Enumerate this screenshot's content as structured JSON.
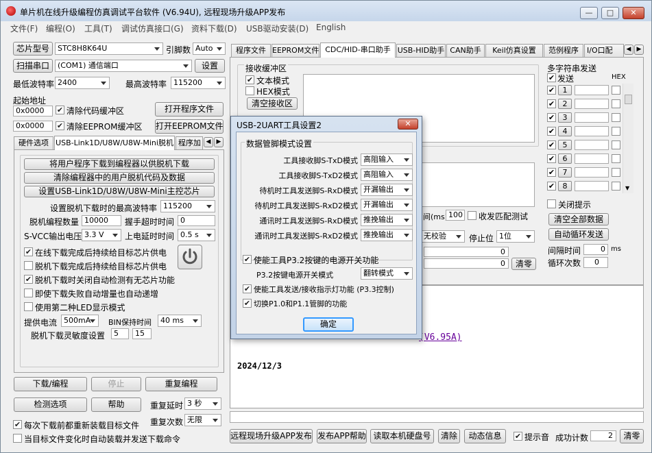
{
  "window": {
    "title": "单片机在线升级编程仿真调试平台软件 (V6.94U), 远程现场升级APP发布",
    "min": "—",
    "max": "□",
    "close": "✕"
  },
  "menu": [
    "文件(F)",
    "编程(O)",
    "工具(T)",
    "调试仿真接口(G)",
    "资料下载(D)",
    "USB驱动安装(D)",
    "English"
  ],
  "left": {
    "chip_model_btn": "芯片型号",
    "chip_model_value": "STC8H8K64U",
    "pin_count_label": "引脚数",
    "pin_count_value": "Auto",
    "scan_port_btn": "扫描串口",
    "port_value": "(COM1) 通信端口",
    "settings_btn": "设置",
    "min_baud_label": "最低波特率",
    "min_baud_value": "2400",
    "max_baud_label": "最高波特率",
    "max_baud_value": "115200",
    "start_addr_label": "起始地址",
    "code_addr": "0x0000",
    "clear_code_buf": "清除代码缓冲区",
    "open_program_btn": "打开程序文件",
    "eeprom_addr": "0x0000",
    "clear_eeprom_buf": "清除EEPROM缓冲区",
    "open_eeprom_btn": "打开EEPROM文件",
    "tabs": [
      "硬件选项",
      "USB-Link1D/U8W/U8W-Mini脱机",
      "程序加"
    ],
    "offline": {
      "btn_download_user": "将用户程序下载到编程器以供脱机下载",
      "btn_clear_user": "清除编程器中的用户脱机代码及数据",
      "btn_set_mini": "设置USB-Link1D/U8W/U8W-Mini主控芯片",
      "max_baud_label": "设置脱机下载时的最高波特率",
      "max_baud_value": "115200",
      "count_label": "脱机编程数量",
      "count_value": "10000",
      "handshake_label": "握手超时时间",
      "handshake_value": "0",
      "svcc_label": "S-VCC输出电压",
      "svcc_value": "3.3 V",
      "power_delay_label": "上电延时时间",
      "power_delay_value": "0.5 s",
      "chk1": "在线下载完成后持续给目标芯片供电",
      "chk2": "脱机下载完成后持续给目标芯片供电",
      "chk3": "脱机下载时关闭自动检测有无芯片功能",
      "chk4": "即使下载失败自动增量也自动递增",
      "chk5": "使用第二种LED显示模式",
      "current_label": "提供电流",
      "current_value": "500mA",
      "bin_hold_label": "BIN保持时间",
      "bin_hold_value": "40 ms",
      "sensitivity_label": "脱机下载灵敏度设置",
      "sens1": "5",
      "sens2": "15"
    },
    "download_btn": "下载/编程",
    "stop_btn": "停止",
    "reprogram_btn": "重复编程",
    "detect_btn": "检测选项",
    "help_btn": "帮助",
    "repeat_delay_label": "重复延时",
    "repeat_delay_value": "3 秒",
    "repeat_count_label": "重复次数",
    "repeat_count_value": "无限",
    "reload_chk": "每次下载前都重新装载目标文件",
    "auto_load_chk": "当目标文件变化时自动装载并发送下载命令"
  },
  "right": {
    "tabs": [
      "程序文件",
      "EEPROM文件",
      "CDC/HID-串口助手",
      "USB-HID助手",
      "CAN助手",
      "Keil仿真设置",
      "范例程序",
      "I/O口配"
    ],
    "recv_buffer_label": "接收缓冲区",
    "text_mode": "文本模式",
    "hex_mode": "HEX模式",
    "clear_recv_btn": "清空接收区",
    "multi_send_label": "多字符串发送",
    "send_col": "发送",
    "hex_col": "HEX",
    "rows": [
      "1",
      "2",
      "3",
      "4",
      "5",
      "6",
      "7",
      "8"
    ],
    "close_tip": "关闭提示",
    "clear_all_btn": "清空全部数据",
    "auto_loop_btn": "自动循环发送",
    "interval_label": "间隔时间",
    "interval_value": "0",
    "interval_unit": "ms",
    "loop_count_label": "循环次数",
    "loop_count_value": "0",
    "ms_label": "间(ms)",
    "ms_value": "100",
    "match_test": "收发匹配测试",
    "parity_value": "无校验",
    "stop_bit_label": "停止位",
    "stop_bit_value": "1位",
    "count_a": "0",
    "count_b": "0",
    "clear_count_btn": "清零",
    "log_link": "(V6.95A)",
    "log_date": "2024/12/3"
  },
  "bottom": {
    "publish_btn": "远程现场升级APP发布",
    "publish_help_btn": "发布APP帮助",
    "read_disk_btn": "读取本机硬盘号",
    "clear_btn": "清除",
    "anim_btn": "动态信息",
    "sound_chk": "提示音",
    "success_label": "成功计数",
    "success_value": "2",
    "clear_count_btn": "清零"
  },
  "dialog": {
    "title": "USB-2UART工具设置2",
    "close": "✕",
    "group_label": "数据管脚模式设置",
    "rows": [
      {
        "label": "工具接收脚S-TxD模式",
        "value": "高阻输入"
      },
      {
        "label": "工具接收脚S-TxD2模式",
        "value": "高阻输入"
      },
      {
        "label": "待机时工具发送脚S-RxD模式",
        "value": "开漏输出"
      },
      {
        "label": "待机时工具发送脚S-RxD2模式",
        "value": "开漏输出"
      },
      {
        "label": "通讯时工具发送脚S-RxD模式",
        "value": "推挽输出"
      },
      {
        "label": "通讯时工具发送脚S-RxD2模式",
        "value": "推挽输出"
      }
    ],
    "chk_power": "使能工具P3.2按键的电源开关功能",
    "power_mode_label": "P3.2按键电源开关模式",
    "power_mode_value": "翻转模式",
    "chk_led": "使能工具发送/接收指示灯功能 (P3.3控制)",
    "chk_switch": "切换P1.0和P1.1管脚的功能",
    "ok_btn": "确定"
  },
  "colors": {
    "accent": "#3399ff",
    "link": "#660099",
    "dialog_title": "#c3d3e7"
  }
}
